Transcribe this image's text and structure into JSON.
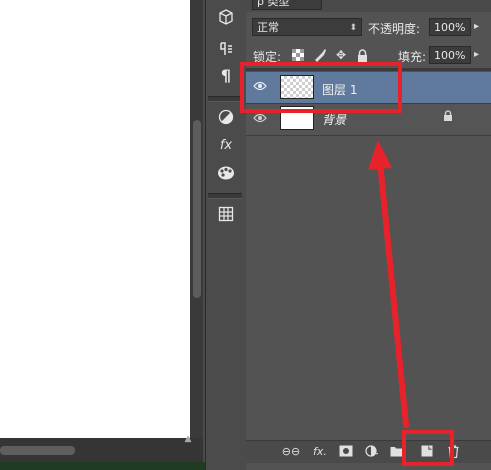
{
  "panel": {
    "filter_type": "类型",
    "blend_mode": "正常",
    "opacity_label": "不透明度:",
    "opacity_value": "100%",
    "lock_label": "锁定:",
    "fill_label": "填充:",
    "fill_value": "100%"
  },
  "layers": [
    {
      "name": "图层 1",
      "selected": true,
      "transparent": true
    },
    {
      "name": "背景",
      "selected": false,
      "locked": true
    }
  ],
  "colors": {
    "highlight": "#e8222b",
    "selected_layer": "#5f7a9c",
    "panel_bg": "#535353"
  },
  "icons": {
    "tools": [
      "3d-icon",
      "paragraph-icon",
      "pilcrow-icon",
      "adjustments-icon",
      "styles-icon",
      "swatches-icon",
      "grid-icon"
    ],
    "bottom": [
      "link-icon",
      "fx-icon",
      "mask-icon",
      "adjustment-layer-icon",
      "group-icon",
      "new-layer-icon",
      "trash-icon"
    ]
  }
}
